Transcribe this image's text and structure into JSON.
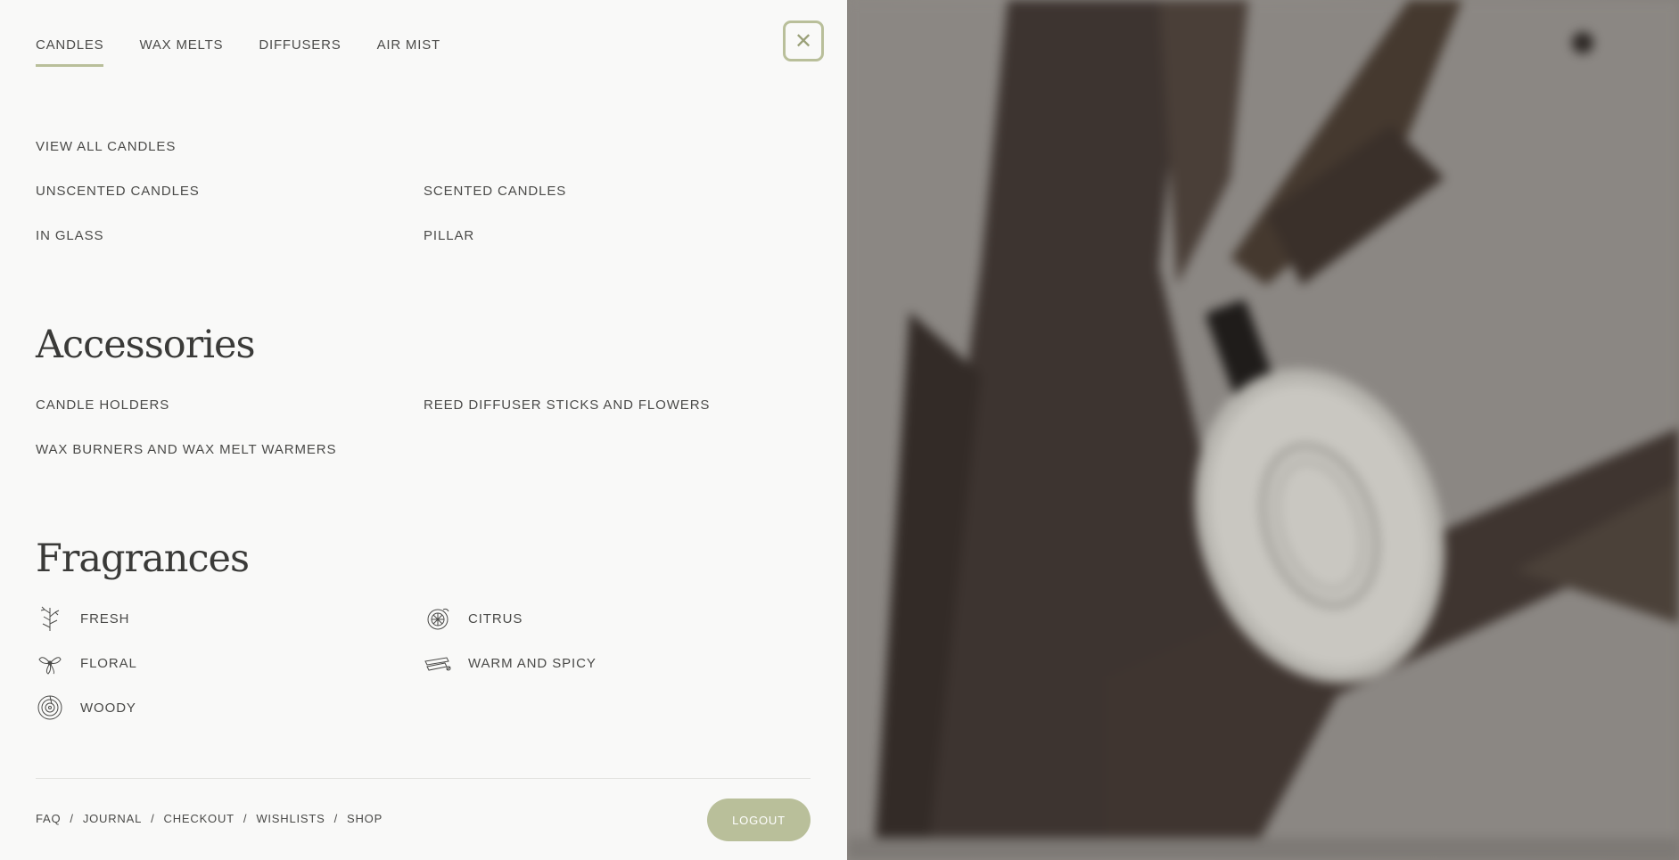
{
  "tabs": [
    {
      "label": "CANDLES",
      "active": true
    },
    {
      "label": "WAX MELTS",
      "active": false
    },
    {
      "label": "DIFFUSERS",
      "active": false
    },
    {
      "label": "AIR MIST",
      "active": false
    }
  ],
  "close_icon": "close-icon",
  "candles": {
    "view_all": "VIEW ALL CANDLES",
    "links": [
      "UNSCENTED CANDLES",
      "SCENTED CANDLES",
      "IN GLASS",
      "PILLAR"
    ]
  },
  "accessories": {
    "heading": "Accessories",
    "links": [
      "CANDLE HOLDERS",
      "REED DIFFUSER STICKS AND FLOWERS",
      "WAX BURNERS AND WAX MELT WARMERS"
    ]
  },
  "fragrances": {
    "heading": "Fragrances",
    "items": [
      {
        "label": "FRESH",
        "icon": "fresh-herb-icon"
      },
      {
        "label": "CITRUS",
        "icon": "citrus-icon"
      },
      {
        "label": "FLORAL",
        "icon": "floral-icon"
      },
      {
        "label": "WARM AND SPICY",
        "icon": "cinnamon-icon"
      },
      {
        "label": "WOODY",
        "icon": "wood-icon"
      }
    ]
  },
  "footer": {
    "links": [
      "FAQ",
      "JOURNAL",
      "CHECKOUT",
      "WISHLISTS",
      "SHOP"
    ],
    "logout": "LOGOUT"
  },
  "colors": {
    "accent": "#b9bf9a",
    "panel_bg": "#f9f9f8",
    "text": "#4a4a48"
  }
}
